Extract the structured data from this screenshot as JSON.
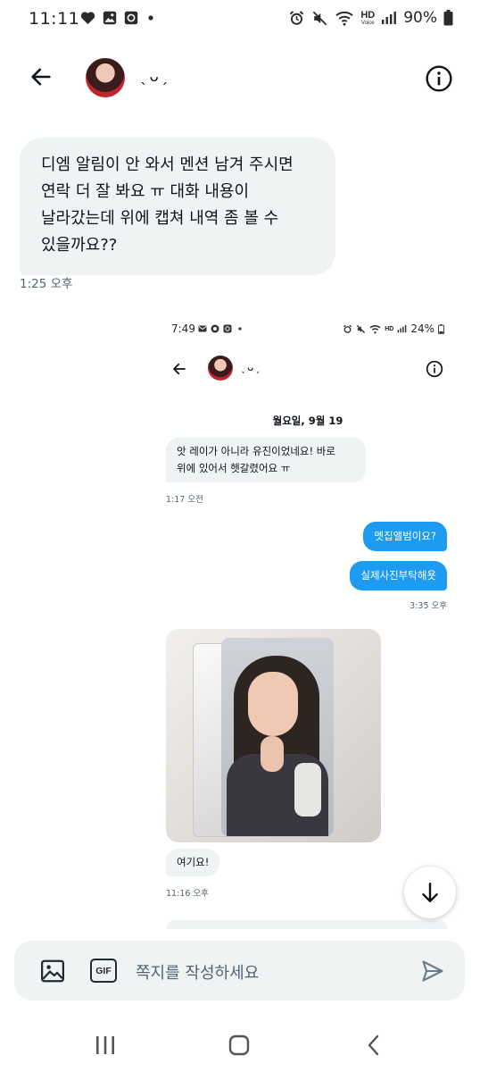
{
  "status_bar": {
    "time": "11:11",
    "battery": "90%",
    "hd_label": "HD",
    "voice_label": "Voice"
  },
  "header": {
    "contact_name": "ˎᴗˏ",
    "back_icon": "arrow-left-icon",
    "info_icon": "info-circle-icon"
  },
  "messages": [
    {
      "direction": "received",
      "text": "디엠 알림이 안 와서 멘션 남겨 주시면\n연락 더 잘 봐요 ㅠ 대화 내용이\n날라갔는데 위에 캡쳐 내역 좀 볼 수\n있을까요??",
      "time": "1:25 오후"
    }
  ],
  "attached_screenshot": {
    "status_time": "7:49",
    "battery": "24%",
    "contact_name": "ˎᴗˏ",
    "date_header": "월요일, 9월 19",
    "messages": [
      {
        "direction": "received",
        "text": "앗 레이가 아니라 유진이었네요! 바로\n위에 있어서 헷갈렸어요 ㅠ",
        "time": "1:17 오전"
      },
      {
        "direction": "sent",
        "text": "멧집앨범이요?"
      },
      {
        "direction": "sent",
        "text": "실제사진부탁해욧",
        "time": "3:35 오후"
      },
      {
        "direction": "received",
        "type": "photo",
        "description": "photocard-in-sleeve"
      },
      {
        "direction": "received",
        "text": "여기요!",
        "time": "11:16 오후"
      }
    ]
  },
  "composer": {
    "placeholder": "쪽지를 작성하세요",
    "gif_label": "GIF",
    "image_icon": "image-icon",
    "send_icon": "send-icon"
  },
  "colors": {
    "accent": "#1d9bf0",
    "bubble_received": "#eff3f4",
    "text_primary": "#0f1419",
    "text_secondary": "#536471"
  }
}
